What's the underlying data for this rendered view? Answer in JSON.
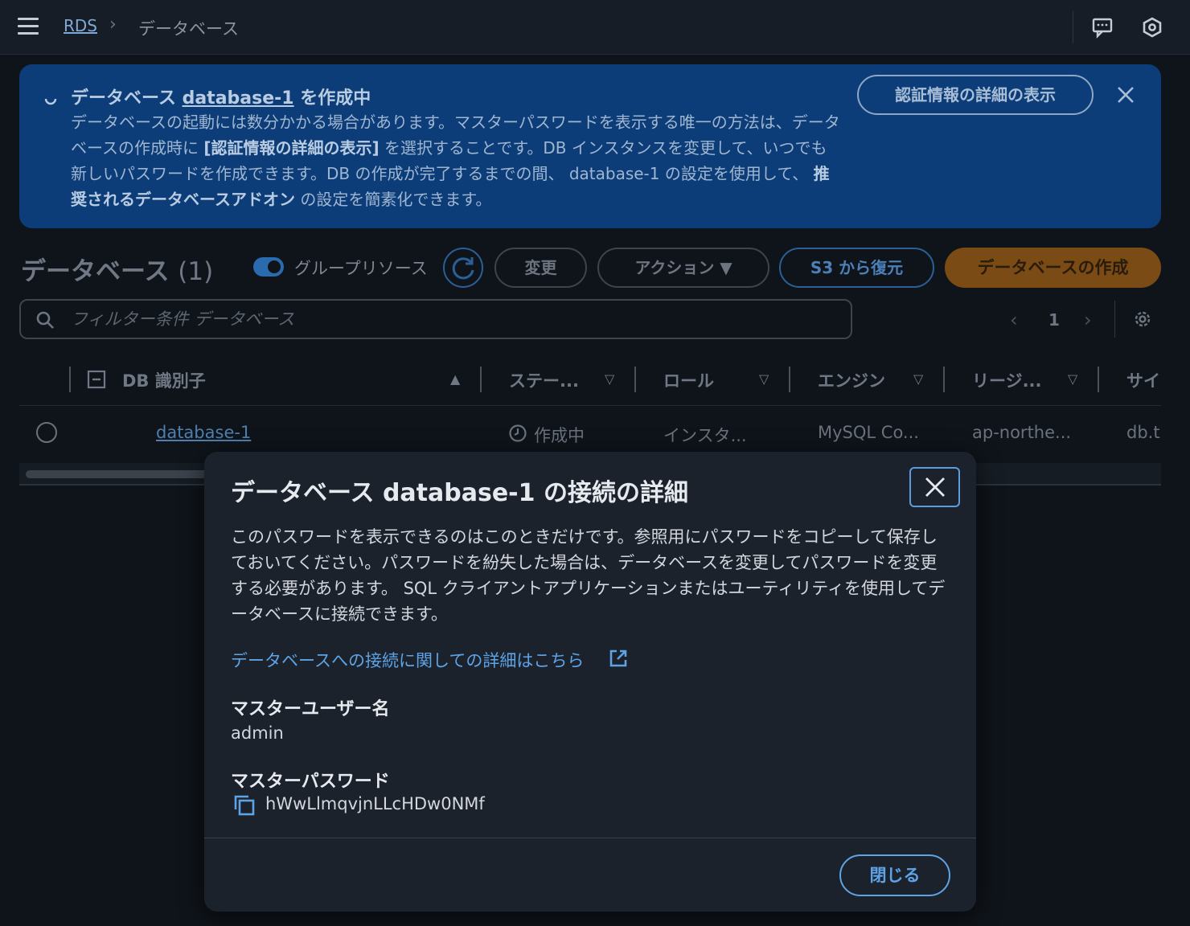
{
  "breadcrumb": {
    "root": "RDS",
    "separator": "›",
    "current": "データベース"
  },
  "topbar_icons": [
    "feedback-icon",
    "settings-icon"
  ],
  "flash": {
    "title_prefix": "データベース",
    "title_link": "database-1",
    "title_suffix": "を作成中",
    "body_part1": "データベースの起動には数分かかる場合があります。マスターパスワードを表示する唯一の方法は、データベースの作成時に",
    "body_bold": "[認証情報の詳細の表示]",
    "body_part2": "を選択することです。DB インスタンスを変更して、いつでも新しいパスワードを作成できます。DB の作成が完了するまでの間、 database-1 の設定を使用して、",
    "body_bold2": "推奨されるデータベースアドオン",
    "body_part3": "の設定を簡素化できます。",
    "button": "認証情報の詳細の表示",
    "color": "#0d3d78"
  },
  "section": {
    "title": "データベース",
    "count": "(1)",
    "group_toggle_label": "グループリソース",
    "modify": "変更",
    "actions": "アクション ▼",
    "restore_s3": "S3 から復元",
    "create": "データベースの作成"
  },
  "filter": {
    "placeholder": "フィルター条件 データベース"
  },
  "pager": {
    "prev": "‹",
    "page": "1",
    "next": "›"
  },
  "table": {
    "columns": [
      "DB 識別子",
      "ステー...",
      "ロール",
      "エンジン",
      "リージ...",
      "サイ"
    ],
    "rows": [
      {
        "id": "database-1",
        "status": "作成中",
        "role": "インスタ...",
        "engine": "MySQL Co...",
        "region": "ap-northe...",
        "size": "db.t"
      }
    ]
  },
  "modal": {
    "title": "データベース database-1 の接続の詳細",
    "description": "このパスワードを表示できるのはこのときだけです。参照用にパスワードをコピーして保存しておいてください。パスワードを紛失した場合は、データベースを変更してパスワードを変更する必要があります。 SQL クライアントアプリケーションまたはユーティリティを使用してデータベースに接続できます。",
    "learn_more_link": "データベースへの接続に関しての詳細はこちら",
    "master_user_label": "マスターユーザー名",
    "master_user_value": "admin",
    "master_password_label": "マスターパスワード",
    "master_password_value": "hWwLlmqvjnLLcHDw0NMf",
    "close_button": "閉じる",
    "accent_color": "#5ea3e6"
  }
}
